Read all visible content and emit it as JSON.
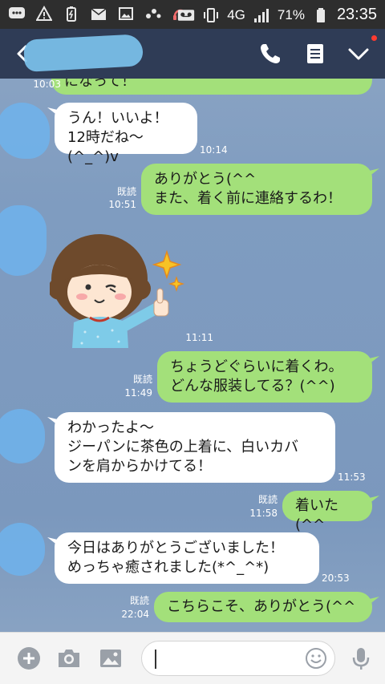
{
  "statusbar": {
    "network": "4G",
    "battery": "71%",
    "time": "23:35",
    "icons": [
      "messages-icon",
      "alert-icon",
      "battery-saver-icon",
      "mail-icon",
      "image-icon",
      "dots-icon",
      "headset-icon",
      "voicemail-icon",
      "vibrate-icon",
      "signal-icon",
      "battery-icon"
    ]
  },
  "header": {
    "icons": [
      "back-icon",
      "call-icon",
      "notes-icon",
      "menu-chevron-icon"
    ]
  },
  "messages": [
    {
      "dir": "in",
      "text": "になって！",
      "time": "10:03"
    },
    {
      "dir": "in",
      "text": "うん！いいよ！\n12時だね〜(^_^)v",
      "time": "10:14"
    },
    {
      "dir": "out",
      "text": "ありがとう(^^\nまた、着く前に連絡するわ！",
      "read": "既読",
      "time": "10:51"
    },
    {
      "dir": "in",
      "type": "sticker",
      "sticker": "girl-thumbs-up-sticker",
      "time": "11:11"
    },
    {
      "dir": "out",
      "text": "ちょうどぐらいに着くわ。\nどんな服装してる？(^^)",
      "read": "既読",
      "time": "11:49"
    },
    {
      "dir": "in",
      "text": "わかったよ〜\nジーパンに茶色の上着に、白いカバ\nンを肩からかけてる！",
      "time": "11:53"
    },
    {
      "dir": "out",
      "text": "着いた(^^",
      "read": "既読",
      "time": "11:58"
    },
    {
      "dir": "in",
      "text": "今日はありがとうございました！\nめっちゃ癒されました(*^_^*)",
      "time": "20:53"
    },
    {
      "dir": "out",
      "text": "こちらこそ、ありがとう(^^",
      "read": "既読",
      "time": "22:04"
    }
  ],
  "input": {
    "placeholder": ""
  },
  "toolbar_icons": [
    "plus-icon",
    "camera-icon",
    "photo-icon",
    "emoji-icon",
    "microphone-icon"
  ],
  "colors": {
    "outgoing": "#a3e07a",
    "incoming": "#ffffff",
    "header": "#2f3c56",
    "background": "#7f9cc0"
  }
}
